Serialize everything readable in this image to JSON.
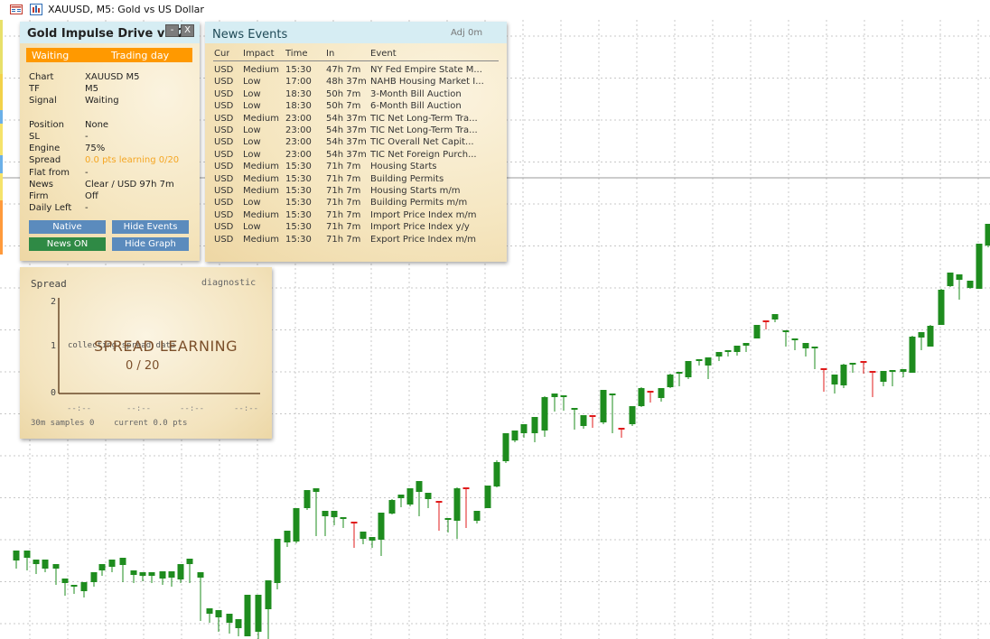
{
  "window": {
    "title": "XAUUSD, M5:  Gold vs US Dollar"
  },
  "ea_panel": {
    "title": "Gold Impulse Drive v1.2",
    "minimize": "-",
    "close": "X",
    "state_left": "Waiting",
    "state_right": "Trading day",
    "rows": [
      {
        "label": "Chart",
        "value": "XAUUSD M5"
      },
      {
        "label": "TF",
        "value": "M5"
      },
      {
        "label": "Signal",
        "value": "Waiting"
      },
      {
        "label": "Position",
        "value": "None"
      },
      {
        "label": "SL",
        "value": "-"
      },
      {
        "label": "Engine",
        "value": "75%"
      },
      {
        "label": "Spread",
        "value": "0.0 pts learning 0/20"
      },
      {
        "label": "Flat from",
        "value": "-"
      },
      {
        "label": "News",
        "value": "Clear / USD 97h 7m"
      },
      {
        "label": "Firm",
        "value": "Off"
      },
      {
        "label": "Daily Left",
        "value": "-"
      }
    ],
    "buttons": {
      "native": "Native",
      "hide_events": "Hide Events",
      "news_on": "News ON",
      "hide_graph": "Hide Graph"
    },
    "colors": {
      "state_bar": "#ff9900",
      "spread_value": "#f5a623",
      "btn_blue": "#5b8bbd",
      "btn_green": "#2f8a45"
    }
  },
  "news_panel": {
    "title": "News Events",
    "adj": "Adj 0m",
    "headers": {
      "cur": "Cur",
      "impact": "Impact",
      "time": "Time",
      "in": "In",
      "event": "Event"
    },
    "rows": [
      {
        "cur": "USD",
        "impact": "Medium",
        "time": "15:30",
        "in": "47h 7m",
        "event": "NY Fed Empire State M..."
      },
      {
        "cur": "USD",
        "impact": "Low",
        "time": "17:00",
        "in": "48h 37m",
        "event": "NAHB Housing Market I..."
      },
      {
        "cur": "USD",
        "impact": "Low",
        "time": "18:30",
        "in": "50h 7m",
        "event": "3-Month Bill Auction"
      },
      {
        "cur": "USD",
        "impact": "Low",
        "time": "18:30",
        "in": "50h 7m",
        "event": "6-Month Bill Auction"
      },
      {
        "cur": "USD",
        "impact": "Medium",
        "time": "23:00",
        "in": "54h 37m",
        "event": "TIC Net Long-Term Tra..."
      },
      {
        "cur": "USD",
        "impact": "Low",
        "time": "23:00",
        "in": "54h 37m",
        "event": "TIC Net Long-Term Tra..."
      },
      {
        "cur": "USD",
        "impact": "Low",
        "time": "23:00",
        "in": "54h 37m",
        "event": "TIC Overall Net Capit..."
      },
      {
        "cur": "USD",
        "impact": "Low",
        "time": "23:00",
        "in": "54h 37m",
        "event": "TIC Net Foreign Purch..."
      },
      {
        "cur": "USD",
        "impact": "Medium",
        "time": "15:30",
        "in": "71h 7m",
        "event": "Housing Starts"
      },
      {
        "cur": "USD",
        "impact": "Medium",
        "time": "15:30",
        "in": "71h 7m",
        "event": "Building Permits"
      },
      {
        "cur": "USD",
        "impact": "Medium",
        "time": "15:30",
        "in": "71h 7m",
        "event": "Housing Starts m/m"
      },
      {
        "cur": "USD",
        "impact": "Low",
        "time": "15:30",
        "in": "71h 7m",
        "event": "Building Permits m/m"
      },
      {
        "cur": "USD",
        "impact": "Medium",
        "time": "15:30",
        "in": "71h 7m",
        "event": "Import Price Index m/m"
      },
      {
        "cur": "USD",
        "impact": "Low",
        "time": "15:30",
        "in": "71h 7m",
        "event": "Import Price Index y/y"
      },
      {
        "cur": "USD",
        "impact": "Medium",
        "time": "15:30",
        "in": "71h 7m",
        "event": "Export Price Index m/m"
      }
    ]
  },
  "spread_panel": {
    "title": "Spread",
    "mode": "diagnostic",
    "y_ticks": [
      "2",
      "1",
      "0"
    ],
    "x_ticks": [
      "--:--",
      "--:--",
      "--:--",
      "--:--"
    ],
    "collecting": "collecting spread data",
    "learning": "SPREAD LEARNING",
    "progress": "0 / 20",
    "footer": "30m samples 0    current 0.0 pts"
  },
  "chart": {
    "symbol": "XAUUSD",
    "timeframe": "M5",
    "colors": {
      "bull": "#1e8c1e",
      "bear": "#e01b1b",
      "grid": "#c8c8c8",
      "level": "#9a9a9a"
    },
    "candles": [
      [
        18,
        621,
        610,
        616,
        630
      ],
      [
        30,
        618,
        610,
        614,
        632
      ],
      [
        40,
        625,
        620,
        631,
        636
      ],
      [
        50,
        630,
        620,
        628,
        634
      ],
      [
        62,
        630,
        625,
        644,
        648
      ],
      [
        72,
        646,
        641,
        655,
        660
      ],
      [
        82,
        650,
        648,
        655,
        658
      ],
      [
        93,
        655,
        645,
        654,
        662
      ],
      [
        104,
        645,
        634,
        645,
        650
      ],
      [
        113,
        632,
        625,
        630,
        638
      ],
      [
        124,
        628,
        620,
        621,
        634
      ],
      [
        136,
        626,
        618,
        638,
        645
      ],
      [
        148,
        637,
        632,
        640,
        646
      ],
      [
        158,
        638,
        634,
        641,
        644
      ],
      [
        168,
        638,
        634,
        643,
        646
      ],
      [
        180,
        641,
        633,
        642,
        648
      ],
      [
        190,
        640,
        633,
        646,
        650
      ],
      [
        200,
        642,
        625,
        643,
        646
      ],
      [
        210,
        625,
        619,
        637,
        646
      ],
      [
        222,
        640,
        634,
        683,
        688
      ],
      [
        232,
        680,
        674,
        684,
        690
      ],
      [
        242,
        684,
        676,
        693,
        700
      ],
      [
        254,
        690,
        680,
        697,
        702
      ],
      [
        264,
        696,
        686,
        700,
        705
      ],
      [
        274,
        705,
        659,
        663,
        705
      ],
      [
        286,
        700,
        659,
        673,
        708
      ],
      [
        297,
        675,
        643,
        646,
        708
      ],
      [
        307,
        646,
        597,
        649,
        653
      ],
      [
        318,
        601,
        588,
        602,
        606
      ],
      [
        328,
        600,
        563,
        566,
        602
      ],
      [
        340,
        563,
        543,
        547,
        565
      ],
      [
        350,
        545,
        541,
        592,
        594
      ],
      [
        360,
        572,
        566,
        590,
        594
      ],
      [
        370,
        573,
        566,
        578,
        582
      ],
      [
        380,
        575,
        573,
        581,
        585
      ],
      [
        392,
        578,
        578,
        589,
        607
      ],
      [
        402,
        597,
        589,
        600,
        603
      ],
      [
        412,
        599,
        595,
        604,
        607
      ],
      [
        422,
        598,
        568,
        568,
        616
      ],
      [
        434,
        569,
        554,
        553,
        570
      ],
      [
        444,
        552,
        548,
        558,
        562
      ],
      [
        454,
        559,
        541,
        545,
        561
      ],
      [
        464,
        545,
        533,
        551,
        572
      ],
      [
        474,
        553,
        546,
        557,
        563
      ],
      [
        486,
        555,
        556,
        585,
        588
      ],
      [
        496,
        576,
        574,
        586,
        590
      ],
      [
        506,
        577,
        541,
        540,
        597
      ],
      [
        516,
        540,
        541,
        576,
        585
      ],
      [
        528,
        577,
        566,
        568,
        580
      ],
      [
        540,
        563,
        538,
        540,
        563
      ],
      [
        550,
        539,
        512,
        510,
        540
      ],
      [
        560,
        511,
        480,
        486,
        513
      ],
      [
        570,
        488,
        477,
        481,
        490
      ],
      [
        580,
        480,
        470,
        475,
        485
      ],
      [
        592,
        480,
        462,
        483,
        490
      ],
      [
        603,
        477,
        440,
        439,
        484
      ],
      [
        614,
        440,
        436,
        440,
        456
      ],
      [
        624,
        440,
        438,
        450,
        455
      ],
      [
        636,
        454,
        452,
        472,
        476
      ],
      [
        646,
        472,
        460,
        461,
        475
      ],
      [
        656,
        460,
        460,
        470,
        474
      ],
      [
        668,
        468,
        432,
        432,
        470
      ],
      [
        678,
        437,
        436,
        474,
        480
      ],
      [
        688,
        474,
        474,
        476,
        485
      ],
      [
        700,
        470,
        450,
        450,
        472
      ],
      [
        710,
        450,
        430,
        429,
        451
      ],
      [
        720,
        433,
        433,
        441,
        446
      ],
      [
        732,
        441,
        430,
        430,
        445
      ],
      [
        742,
        429,
        415,
        414,
        430
      ],
      [
        752,
        414,
        412,
        418,
        428
      ],
      [
        762,
        418,
        400,
        400,
        420
      ],
      [
        774,
        400,
        398,
        403,
        405
      ],
      [
        784,
        405,
        396,
        396,
        420
      ],
      [
        796,
        395,
        390,
        390,
        400
      ],
      [
        806,
        390,
        388,
        391,
        395
      ],
      [
        816,
        390,
        383,
        383,
        394
      ],
      [
        826,
        383,
        380,
        380,
        390
      ],
      [
        838,
        375,
        360,
        360,
        375
      ],
      [
        848,
        355,
        355,
        360,
        365
      ],
      [
        858,
        354,
        348,
        356,
        357
      ],
      [
        870,
        367,
        366,
        380,
        384
      ],
      [
        880,
        376,
        375,
        386,
        388
      ],
      [
        892,
        386,
        380,
        380,
        395
      ],
      [
        902,
        386,
        384,
        409,
        409
      ],
      [
        912,
        408,
        408,
        421,
        434
      ],
      [
        924,
        426,
        415,
        430,
        436
      ],
      [
        934,
        427,
        404,
        403,
        430
      ],
      [
        944,
        404,
        402,
        408,
        413
      ],
      [
        956,
        400,
        400,
        412,
        414
      ],
      [
        966,
        411,
        411,
        423,
        440
      ],
      [
        978,
        423,
        411,
        426,
        428
      ],
      [
        988,
        412,
        410,
        424,
        428
      ],
      [
        1000,
        412,
        409,
        412,
        418
      ],
      [
        1010,
        413,
        373,
        372,
        413
      ],
      [
        1020,
        374,
        368,
        384,
        388
      ],
      [
        1030,
        384,
        361,
        360,
        384
      ],
      [
        1042,
        360,
        321,
        320,
        360
      ],
      [
        1052,
        317,
        302,
        318,
        318
      ],
      [
        1062,
        310,
        304,
        320,
        332
      ],
      [
        1074,
        319,
        311,
        318,
        320
      ],
      [
        1084,
        320,
        270,
        272,
        320
      ],
      [
        1094,
        272,
        248,
        254,
        274
      ]
    ]
  }
}
